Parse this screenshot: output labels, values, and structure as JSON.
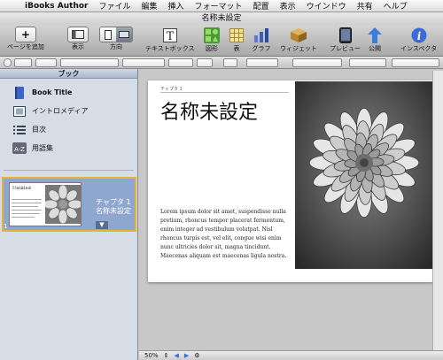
{
  "menubar": {
    "app": "iBooks Author",
    "items": [
      "ファイル",
      "編集",
      "挿入",
      "フォーマット",
      "配置",
      "表示",
      "ウインドウ",
      "共有",
      "ヘルプ"
    ]
  },
  "window": {
    "title": "名称未設定"
  },
  "toolbar": {
    "add_page": "ページを追加",
    "view": "表示",
    "orientation": "方向",
    "textbox": "テキストボックス",
    "shapes": "図形",
    "table": "表",
    "chart": "グラフ",
    "widget": "ウィジェット",
    "preview": "プレビュー",
    "publish": "公開",
    "inspector": "インスペクタ"
  },
  "sidebar": {
    "header": "ブック",
    "items": [
      {
        "label": "Book Title",
        "icon": "book-icon"
      },
      {
        "label": "イントロメディア",
        "icon": "film-icon"
      },
      {
        "label": "目次",
        "icon": "list-icon"
      },
      {
        "label": "用語集",
        "icon": "glossary-icon"
      }
    ],
    "chapter": {
      "thumb_title": "Untitled",
      "title_line1": "チャプタ 1",
      "title_line2": "名称未設定",
      "number": "1"
    }
  },
  "page": {
    "chapter_label": "チャプタ 1",
    "title": "名称未設定",
    "body": "Lorem ipsum dolor sit amet, suspendisse nulla pretium, rhoncus tempor placerat fermentum, enim integer ad vestibulum volutpat. Nisl rhoncus turpis est, vel elit, congue wisi enim nunc ultricies dolor sit, magna tincidunt. Maecenas aliquam est maecenas ligula nostra."
  },
  "statusbar": {
    "zoom": "50%"
  },
  "colors": {
    "sidebar_bg": "#d6dde6",
    "chapter_bg": "#8fa6cf",
    "selection_border": "#e5b430"
  }
}
